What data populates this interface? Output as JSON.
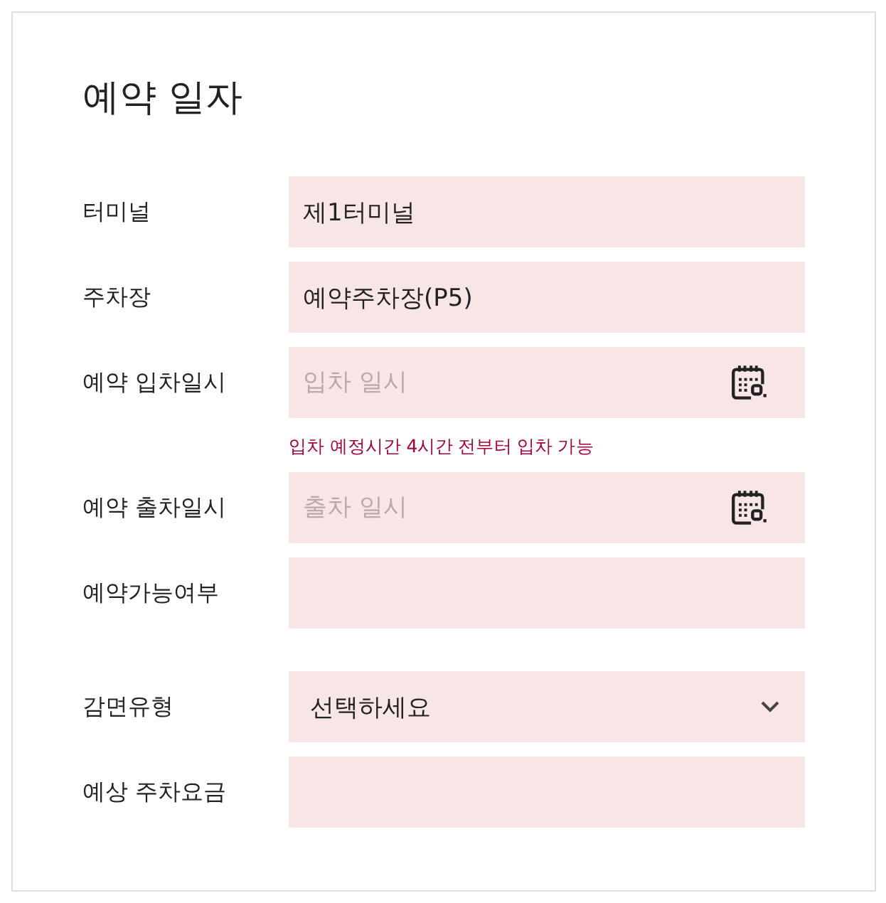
{
  "section": {
    "title": "예약 일자"
  },
  "groups": [
    [
      {
        "kind": "text",
        "label": "터미널",
        "value": "제1터미널"
      },
      {
        "kind": "text",
        "label": "주차장",
        "value": "예약주차장(P5)"
      },
      {
        "kind": "date",
        "label": "예약 입차일시",
        "placeholder": "입차 일시",
        "hint": "입차 예정시간 4시간 전부터 입차 가능"
      },
      {
        "kind": "date",
        "label": "예약 출차일시",
        "placeholder": "출차 일시"
      },
      {
        "kind": "text",
        "label": "예약가능여부"
      }
    ],
    [
      {
        "kind": "select",
        "label": "감면유형",
        "value": "선택하세요"
      },
      {
        "kind": "text",
        "label": "예상 주차요금"
      }
    ]
  ]
}
